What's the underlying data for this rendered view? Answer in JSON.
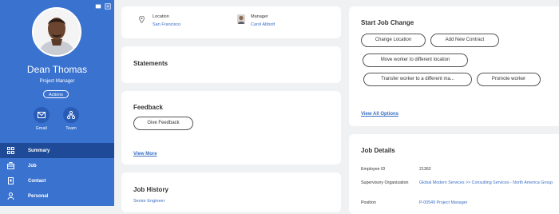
{
  "profile": {
    "name": "Dean Thomas",
    "title": "Project Manager",
    "actions_label": "Actions"
  },
  "quick_actions": [
    {
      "label": "Email",
      "icon": "mail-icon"
    },
    {
      "label": "Team",
      "icon": "org-chart-icon"
    }
  ],
  "nav": [
    {
      "label": "Summary",
      "icon": "grid-icon",
      "active": true
    },
    {
      "label": "Job",
      "icon": "briefcase-icon",
      "active": false
    },
    {
      "label": "Contact",
      "icon": "contact-card-icon",
      "active": false
    },
    {
      "label": "Personal",
      "icon": "person-icon",
      "active": false
    }
  ],
  "info": {
    "location_label": "Location",
    "location_value": "San Francisco",
    "manager_label": "Manager",
    "manager_value": "Carol Abbott"
  },
  "statements": {
    "title": "Statements"
  },
  "feedback": {
    "title": "Feedback",
    "button": "Give Feedback",
    "view_more": "View More"
  },
  "job_history": {
    "title": "Job History",
    "first_item": "Senior Engineer"
  },
  "job_change": {
    "title": "Start Job Change",
    "buttons": [
      "Change Location",
      "Add New Contract",
      "Move worker to different location",
      "Transfer worker to a different ma...",
      "Promote worker"
    ],
    "view_all": "View All Options"
  },
  "job_details": {
    "title": "Job Details",
    "rows": [
      {
        "key": "Employee ID",
        "value": "21362"
      },
      {
        "key": "Supervisory Organization",
        "value": "Global Modern Services >> Consulting Services - North America Group"
      },
      {
        "key": "Position",
        "value": "P-00549 Project Manager"
      }
    ]
  },
  "colors": {
    "sidebar": "#3a72d0",
    "sidebar_active": "#1f4a97",
    "link": "#3a6fc4",
    "background": "#f0f1f2"
  }
}
